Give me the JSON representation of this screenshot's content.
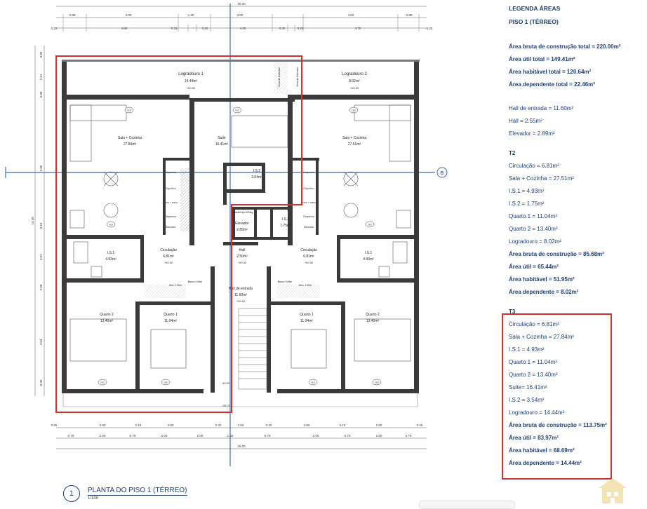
{
  "drawing": {
    "top_total": "15.30",
    "dims_top_row1": [
      "0.85",
      "4.00",
      "1.30",
      "3.00",
      "4.00",
      "0.85"
    ],
    "dims_top_row2": [
      "0.25",
      "4.80",
      "0.33",
      "0.20",
      "4.05",
      "0.30",
      "0.20",
      "4.70",
      "0.25"
    ],
    "dims_bottom_row1": [
      "0.25",
      "2.80",
      "0.15",
      "2.80",
      "0.30",
      "2.50",
      "0.30",
      "2.80",
      "0.15",
      "2.80",
      "0.25"
    ],
    "dims_bottom_row2": [
      "0.70",
      "2.00",
      "0.70",
      "2.00",
      "1.00",
      "1.00",
      "0.70",
      "2.00",
      "0.70",
      "2.00",
      "0.70"
    ],
    "bottom_total": "15.30",
    "dims_left_outer": [
      "0.85",
      "1.51",
      "0.80",
      "5.80",
      "0.15",
      "3.91",
      "2.80",
      "4.04",
      "0.30"
    ],
    "dims_left_total": "14.40",
    "section_label": "B",
    "rooms": {
      "logradouro1": "Logradouro 1",
      "logradouro1_area": "14.44m²",
      "logradouro1_level": "+00.90",
      "logradouro2": "Logradouro 2",
      "logradouro2_area": "8.02m²",
      "logradouro2_level": "+00.90",
      "zona_estendal_1": "Zona de Estendal",
      "zona_estendal_2": "Zona de Estendal",
      "sala_left": "Sala + Cozinha",
      "sala_left_area": "27.84m²",
      "sala_right": "Sala + Cozinha",
      "sala_right_area": "27.51m²",
      "suite": "Suite",
      "suite_area": "16.41m²",
      "is2_left": "I.S.2",
      "is2_left_area": "3.54m²",
      "is2_right": "I.S.2",
      "is2_right_area": "1.75m²",
      "elevador": "Elevador",
      "elevador_area": "2.89m²",
      "elevador_note": "Elevador 6px 630kg",
      "hall": "Hall",
      "hall_area": "2.50m²",
      "hall_level": "+00.92",
      "hall_entrada": "Hall de entrada",
      "hall_entrada_area": "11.60m²",
      "hall_entrada_level": "+00.92",
      "is1_left": "I.S.1",
      "is1_left_area": "4.93m²",
      "is1_right": "I.S.1",
      "is1_right_area": "4.93m²",
      "circ_left": "Circulação",
      "circ_left_area": "6.81m²",
      "circ_left_level": "+00.92",
      "circ_right": "Circulação",
      "circ_right_area": "6.81m²",
      "circ_right_level": "+00.92",
      "quarto2_left": "Quarto 2",
      "quarto2_left_area": "13.40m²",
      "quarto1_left": "Quarto 1",
      "quarto1_left_area": "11.04m²",
      "quarto1_right": "Quarto 1",
      "quarto1_right_area": "11.04m²",
      "quarto2_right": "Quarto 2",
      "quarto2_right_area": "13.40m²",
      "banco_left": "Banco 0.65m",
      "banco_right": "Banco 0.65m",
      "arm_left": "Arm. 1.00m",
      "arm_right": "Arm. 1.00m",
      "level_bottom1": "00.00",
      "level_bottom2": "-00.02",
      "kitchen_labels": [
        "Despensa",
        "Frigorífico",
        "Forno + micro.",
        "Despensa",
        "Bancada"
      ],
      "kitchen_labels_right": [
        "Despensa",
        "Frigorífico",
        "Forno + micro.",
        "Despensa",
        "Bancada"
      ]
    },
    "tag_ved": "VED"
  },
  "legend": {
    "title": "LEGENDA ÁREAS",
    "subtitle": "PISO 1 (TÉRREO)",
    "totals": [
      "Área bruta de construção total = 220.00m²",
      "Área útil total = 149.41m²",
      "Área habitável total = 120.64m²",
      "Área dependente total = 22.46m²"
    ],
    "common": [
      "Hall de entrada = 11.60m²",
      "Hall = 2.55m²",
      "Elevador = 2.89m²"
    ],
    "t2_title": "T2",
    "t2_items": [
      "Circulação = 6.81m²",
      "Sala + Cozinha = 27.51m²",
      "I.S.1 = 4.93m²",
      "I.S.2 = 1.75m²",
      "Quarto 1 = 11.04m²",
      "Quarto 2 = 13.40m²",
      "Logradouro = 8.02m²"
    ],
    "t2_totals": [
      "Área bruta de construção = 85.68m²",
      "Área útil = 65.44m²",
      "Área habitável = 51.95m²",
      "Área dependente = 8.02m²"
    ],
    "t3_title": "T3",
    "t3_items": [
      "Circulação = 6.81m²",
      "Sala + Cozinha = 27.84m²",
      "I.S.1 = 4.93m²",
      "Quarto 1 = 11.04m²",
      "Quarto 2 = 13.40m²",
      "Suite= 16.41m²",
      "I.S.2 = 3.54m²",
      "Logradouro = 14.44m²"
    ],
    "t3_totals": [
      "Área bruta de construção = 113.75m²",
      "Área útil = 83.97m²",
      "Área habitável = 68.69m²",
      "Área dependente = 14.44m²"
    ]
  },
  "title_block": {
    "number": "1",
    "title": "PLANTA DO PISO 1 (TÉRREO)",
    "scale": "1/100"
  },
  "colors": {
    "ink": "#1d3f78",
    "wall": "#333333",
    "highlight": "#d9302a",
    "axis": "#3f6ab8",
    "logo": "#f4e3b3"
  }
}
